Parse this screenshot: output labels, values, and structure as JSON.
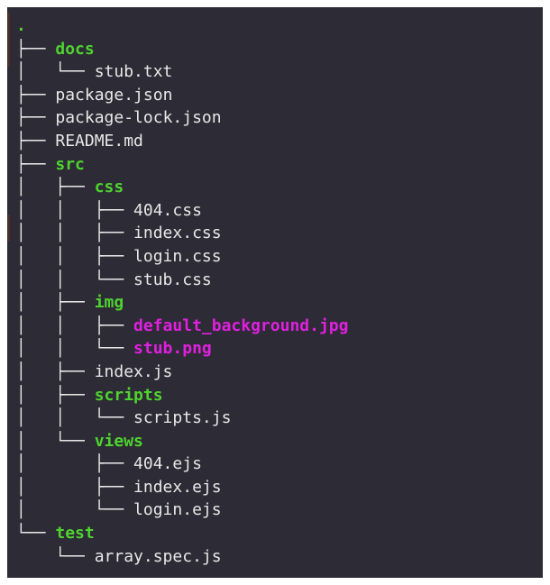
{
  "colors": {
    "background": "#2d2b35",
    "text": "#e8e8e8",
    "directory": "#4ed32f",
    "image_file": "#e020e0"
  },
  "tree": [
    {
      "prefix": "",
      "name": ".",
      "type": "root",
      "icon": "dot"
    },
    {
      "prefix": "├── ",
      "name": "docs",
      "type": "dir"
    },
    {
      "prefix": "│   └── ",
      "name": "stub.txt",
      "type": "file"
    },
    {
      "prefix": "├── ",
      "name": "package.json",
      "type": "file"
    },
    {
      "prefix": "├── ",
      "name": "package-lock.json",
      "type": "file"
    },
    {
      "prefix": "├── ",
      "name": "README.md",
      "type": "file"
    },
    {
      "prefix": "├── ",
      "name": "src",
      "type": "dir"
    },
    {
      "prefix": "│   ├── ",
      "name": "css",
      "type": "dir"
    },
    {
      "prefix": "│   │   ├── ",
      "name": "404.css",
      "type": "file"
    },
    {
      "prefix": "│   │   ├── ",
      "name": "index.css",
      "type": "file"
    },
    {
      "prefix": "│   │   ├── ",
      "name": "login.css",
      "type": "file"
    },
    {
      "prefix": "│   │   └── ",
      "name": "stub.css",
      "type": "file"
    },
    {
      "prefix": "│   ├── ",
      "name": "img",
      "type": "dir"
    },
    {
      "prefix": "│   │   ├── ",
      "name": "default_background.jpg",
      "type": "image"
    },
    {
      "prefix": "│   │   └── ",
      "name": "stub.png",
      "type": "image"
    },
    {
      "prefix": "│   ├── ",
      "name": "index.js",
      "type": "file"
    },
    {
      "prefix": "│   ├── ",
      "name": "scripts",
      "type": "dir"
    },
    {
      "prefix": "│   │   └── ",
      "name": "scripts.js",
      "type": "file"
    },
    {
      "prefix": "│   └── ",
      "name": "views",
      "type": "dir"
    },
    {
      "prefix": "│       ├── ",
      "name": "404.ejs",
      "type": "file"
    },
    {
      "prefix": "│       ├── ",
      "name": "index.ejs",
      "type": "file"
    },
    {
      "prefix": "│       └── ",
      "name": "login.ejs",
      "type": "file"
    },
    {
      "prefix": "└── ",
      "name": "test",
      "type": "dir"
    },
    {
      "prefix": "    └── ",
      "name": "array.spec.js",
      "type": "file"
    }
  ]
}
